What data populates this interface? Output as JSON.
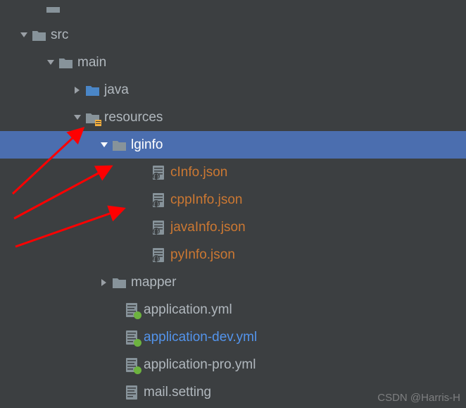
{
  "tree": {
    "src": "src",
    "main": "main",
    "java": "java",
    "resources": "resources",
    "lginfo": "lginfo",
    "cInfo": "cInfo.json",
    "cppInfo": "cppInfo.json",
    "javaInfo": "javaInfo.json",
    "pyInfo": "pyInfo.json",
    "mapper": "mapper",
    "appYml": "application.yml",
    "appDevYml": "application-dev.yml",
    "appProYml": "application-pro.yml",
    "mailSetting": "mail.setting"
  },
  "watermark": "CSDN @Harris-H"
}
